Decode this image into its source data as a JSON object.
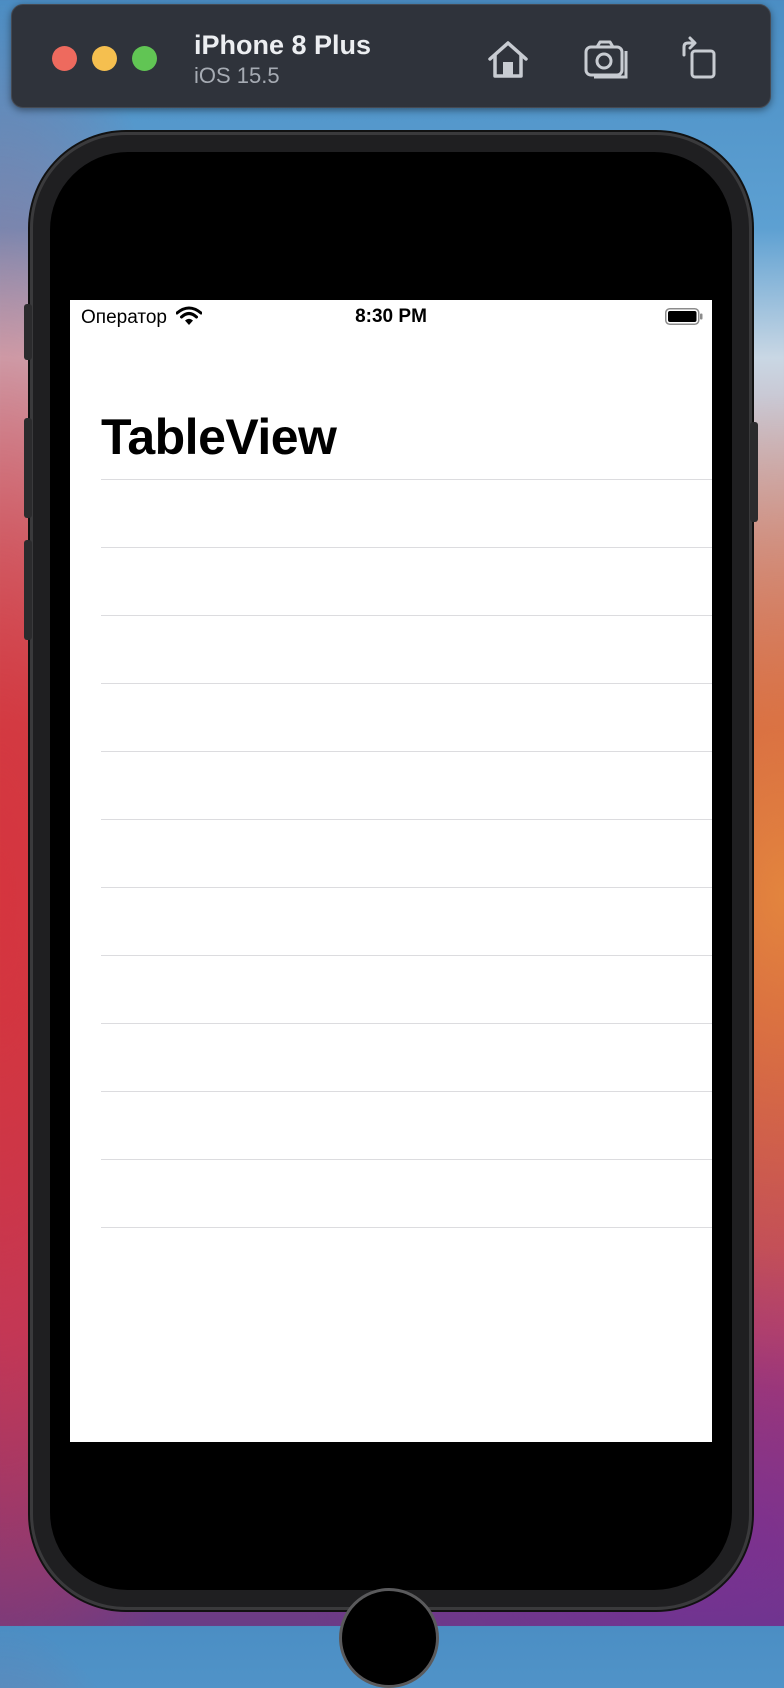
{
  "window": {
    "device_name": "iPhone 8 Plus",
    "os_version": "iOS 15.5",
    "toolbar": [
      {
        "name": "home-icon",
        "label": "Home"
      },
      {
        "name": "screenshot-icon",
        "label": "Screenshot"
      },
      {
        "name": "rotate-icon",
        "label": "Rotate"
      }
    ]
  },
  "status_bar": {
    "carrier": "Оператор",
    "time": "8:30 PM",
    "wifi_icon": "wifi-icon",
    "battery_icon": "battery-full-icon"
  },
  "screen": {
    "title": "TableView",
    "table_rows": [
      "",
      "",
      "",
      "",
      "",
      "",
      "",
      "",
      "",
      "",
      ""
    ]
  },
  "colors": {
    "titlebar": "#2f333b",
    "close": "#ee6a5e",
    "minimize": "#f5bf4f",
    "maximize": "#61c554",
    "separator": "#dcdcdf"
  }
}
